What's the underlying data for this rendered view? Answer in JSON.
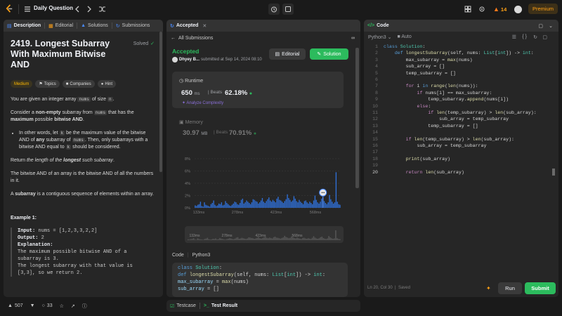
{
  "topbar": {
    "title": "Daily Question",
    "streak": "14",
    "premium": "Premium"
  },
  "left": {
    "tabs": [
      "Description",
      "Editorial",
      "Solutions",
      "Submissions"
    ],
    "title": "2419. Longest Subarray With Maximum Bitwise AND",
    "status": "Solved",
    "tags": [
      "Medium",
      "Topics",
      "Companies",
      "Hint"
    ],
    "p1_a": "You are given an integer array ",
    "p1_code": "nums",
    "p1_b": " of size ",
    "p1_code2": "n",
    "p1_c": ".",
    "p2_a": "Consider a ",
    "p2_b": "non-empty",
    "p2_c": " subarray from ",
    "p2_code": "nums",
    "p2_d": " that has the ",
    "p2_e": "maximum",
    "p2_f": " possible ",
    "p2_g": "bitwise AND",
    "p2_h": ".",
    "b1_a": "In other words, let ",
    "b1_code": "k",
    "b1_b": " be the maximum value of the bitwise AND of ",
    "b1_c": "any",
    "b1_d": " subarray of ",
    "b1_code2": "nums",
    "b1_e": ". Then, only subarrays with a bitwise AND equal to ",
    "b1_code3": "k",
    "b1_f": " should be considered.",
    "p3_a": "Return ",
    "p3_b": "the length of the ",
    "p3_c": "longest",
    "p3_d": " such subarray",
    "p3_e": ".",
    "p4": "The bitwise AND of an array is the bitwise AND of all the numbers in it.",
    "p5_a": "A ",
    "p5_b": "subarray",
    "p5_c": " is a contiguous sequence of elements within an array.",
    "example_label": "Example 1:",
    "ex_input_label": "Input:",
    "ex_input": " nums = [1,2,3,3,2,2]",
    "ex_output_label": "Output:",
    "ex_output": " 2",
    "ex_expl_label": "Explanation:",
    "ex_expl1": "The maximum possible bitwise AND of a",
    "ex_expl2": "subarray is 3.",
    "ex_expl3": "The longest subarray with that value is",
    "ex_expl4": "[3,3], so we return 2.",
    "likes": "507",
    "comments": "33"
  },
  "middle": {
    "tab": "Accepted",
    "back": "All Submissions",
    "status": "Accepted",
    "user": "Dhyey B...",
    "submitted": "submitted at Sep 14, 2024 08:10",
    "editorial_btn": "Editorial",
    "solution_btn": "Solution",
    "runtime_label": "Runtime",
    "runtime_val": "650",
    "runtime_unit": "ms",
    "runtime_beats": "Beats",
    "runtime_pct": "62.18%",
    "analyze": "Analyze Complexity",
    "memory_label": "Memory",
    "memory_val": "30.97",
    "memory_unit": "MB",
    "memory_beats": "Beats",
    "memory_pct": "70.91%",
    "code_label": "Code",
    "code_lang": "Python3",
    "snippet": [
      "class Solution:",
      "    def longestSubarray(self, nums: List[int]) -> int:",
      "        max_subarray = max(nums)",
      "        sub_array = []"
    ],
    "testcase": "Testcase",
    "test_result": "Test Result"
  },
  "chart_data": {
    "type": "bar",
    "title": "",
    "xlabel": "",
    "ylabel": "",
    "y_ticks": [
      "8%",
      "6%",
      "4%",
      "2%",
      "0%"
    ],
    "ylim": [
      0,
      8
    ],
    "x_ticks": [
      "133ms",
      "278ms",
      "423ms",
      "568ms"
    ],
    "values": [
      0.4,
      0.3,
      0.5,
      0.6,
      1.0,
      0.3,
      0.2,
      0.9,
      0.5,
      0.4,
      0.3,
      0.2,
      0.6,
      0.8,
      1.2,
      0.5,
      0.3,
      0.4,
      0.7,
      0.6,
      0.9,
      0.4,
      0.5,
      1.1,
      0.8,
      0.6,
      0.4,
      0.3,
      0.5,
      0.7,
      1.0,
      0.9,
      0.6,
      0.5,
      0.8,
      1.3,
      1.5,
      0.7,
      0.9,
      1.2,
      1.0,
      0.8,
      0.6,
      0.9,
      1.4,
      1.3,
      1.1,
      1.0,
      0.7,
      0.9,
      1.2,
      1.6,
      1.0,
      0.8,
      1.1,
      1.4,
      1.7,
      1.2,
      1.0,
      1.3,
      1.1,
      0.9,
      1.5,
      1.8,
      1.3,
      1.2,
      1.0,
      0.8,
      1.1,
      1.4,
      2.2,
      1.6,
      1.3,
      1.0,
      1.2,
      1.9,
      1.5,
      1.1,
      0.9,
      1.3,
      1.0,
      0.8,
      0.6,
      1.1,
      1.2,
      0.9,
      0.7,
      1.0,
      0.8,
      0.6,
      1.2,
      2.0,
      1.3,
      0.9,
      0.7,
      1.0,
      1.5,
      1.8,
      1.1,
      0.8,
      0.6,
      0.9,
      2.1,
      1.4,
      1.0,
      0.7,
      0.9,
      5.8,
      1.0,
      0.6,
      0.5
    ],
    "highlight_index": 97,
    "colors": {
      "bar": "#2f6fd6",
      "highlight": "#4a8cff",
      "grid": "#3d3d3d"
    }
  },
  "editor": {
    "tab": "Code",
    "lang": "Python3",
    "auto": "Auto",
    "status_pos": "Ln 20, Col 30",
    "status_saved": "Saved",
    "run": "Run",
    "submit": "Submit"
  }
}
